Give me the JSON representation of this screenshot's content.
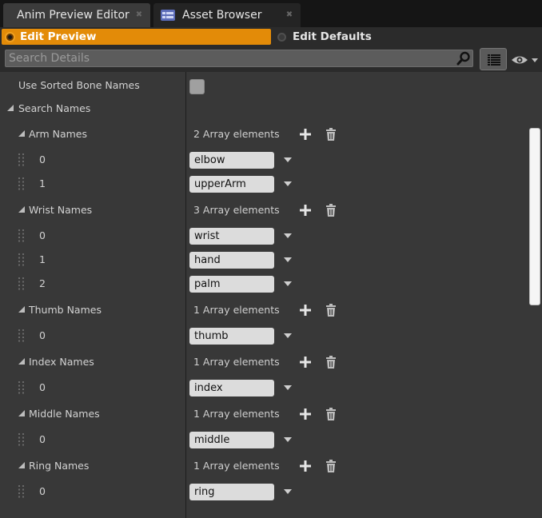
{
  "tabs": [
    {
      "label": "Anim Preview Editor",
      "active": true
    },
    {
      "label": "Asset Browser",
      "active": false
    }
  ],
  "modes": {
    "preview": "Edit Preview",
    "defaults": "Edit Defaults"
  },
  "search": {
    "placeholder": "Search Details"
  },
  "details": {
    "sorted_label": "Use Sorted Bone Names",
    "search_names": "Search Names",
    "groups": [
      {
        "label": "Arm Names",
        "count": "2 Array elements",
        "items": [
          {
            "index": "0",
            "value": "elbow"
          },
          {
            "index": "1",
            "value": "upperArm"
          }
        ]
      },
      {
        "label": "Wrist Names",
        "count": "3 Array elements",
        "items": [
          {
            "index": "0",
            "value": "wrist"
          },
          {
            "index": "1",
            "value": "hand"
          },
          {
            "index": "2",
            "value": "palm"
          }
        ]
      },
      {
        "label": "Thumb Names",
        "count": "1 Array elements",
        "items": [
          {
            "index": "0",
            "value": "thumb"
          }
        ]
      },
      {
        "label": "Index Names",
        "count": "1 Array elements",
        "items": [
          {
            "index": "0",
            "value": "index"
          }
        ]
      },
      {
        "label": "Middle Names",
        "count": "1 Array elements",
        "items": [
          {
            "index": "0",
            "value": "middle"
          }
        ]
      },
      {
        "label": "Ring Names",
        "count": "1 Array elements",
        "items": [
          {
            "index": "0",
            "value": "ring"
          }
        ]
      }
    ]
  },
  "colors": {
    "accent": "#e38b08",
    "panel": "#383838",
    "field": "#dcdcdc"
  }
}
